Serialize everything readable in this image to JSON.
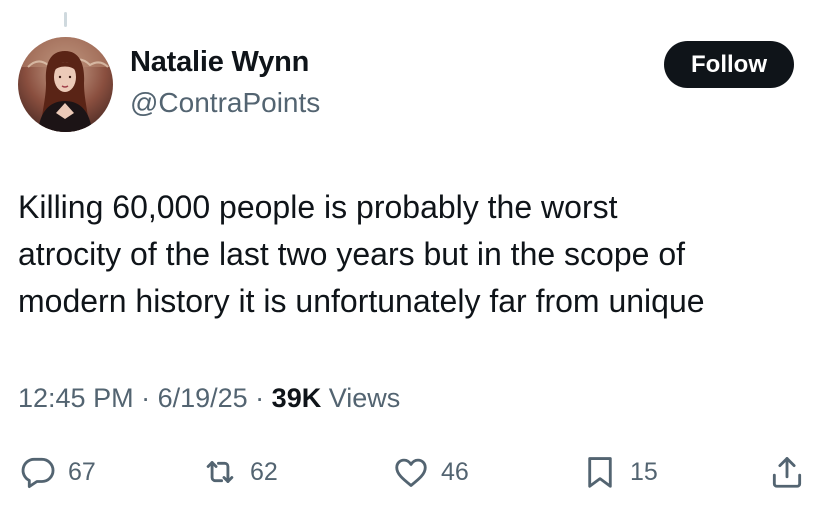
{
  "author": {
    "name": "Natalie Wynn",
    "handle": "@ContraPoints",
    "follow_label": "Follow"
  },
  "tweet": {
    "lines": [
      "Killing 60,000 people is probably the worst",
      "atrocity of the last two years but in the scope of",
      "modern history it is unfortunately far from unique"
    ]
  },
  "meta": {
    "time": "12:45 PM",
    "sep1": " · ",
    "date": "6/19/25",
    "sep2": " · ",
    "views_count": "39K",
    "views_label": " Views"
  },
  "actions": {
    "replies": "67",
    "reposts": "62",
    "likes": "46",
    "bookmarks": "15"
  },
  "icons": {
    "reply": "speech-bubble-icon",
    "repost": "repost-arrows-icon",
    "like": "heart-icon",
    "bookmark": "bookmark-icon",
    "share": "share-upload-icon"
  },
  "colors": {
    "text": "#0f1419",
    "secondary": "#536471",
    "button_bg": "#0f1419",
    "button_text": "#ffffff"
  }
}
